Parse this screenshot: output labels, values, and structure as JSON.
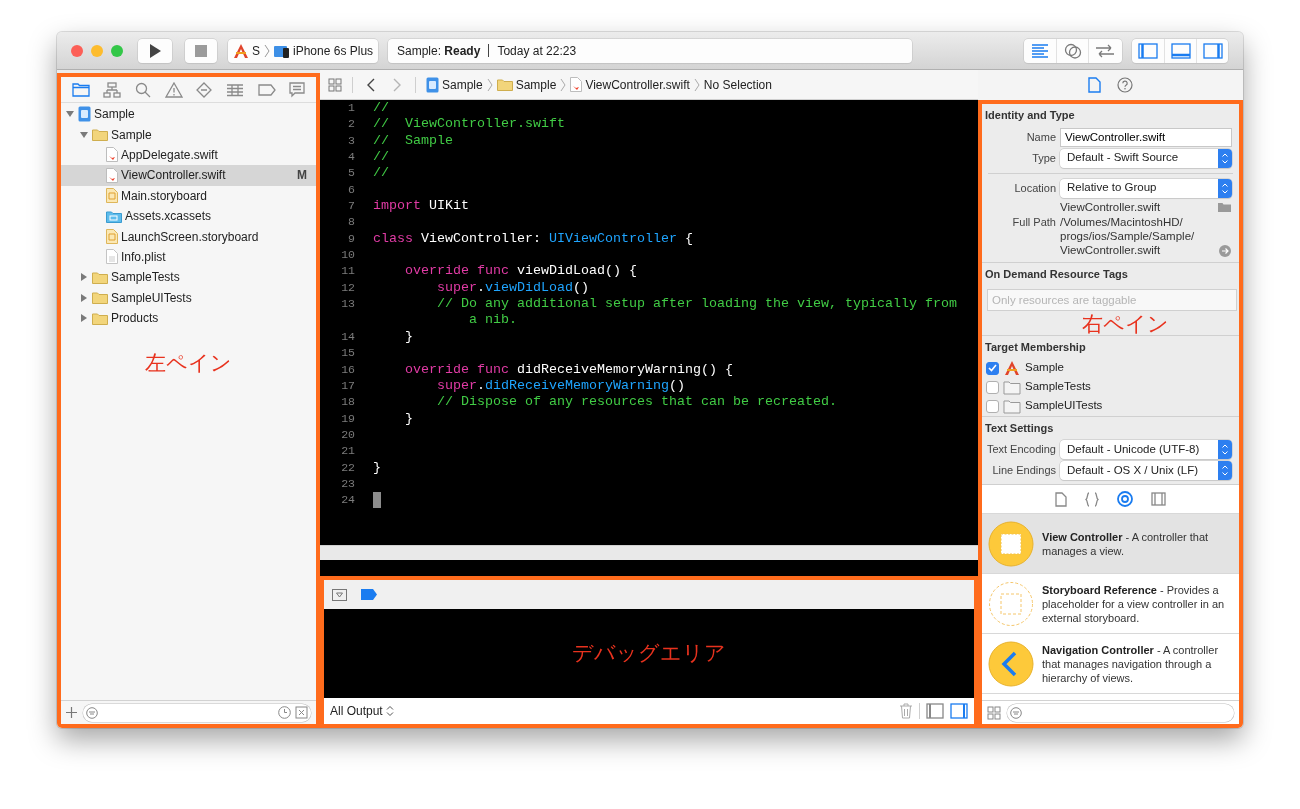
{
  "toolbar": {
    "scheme": "S",
    "destination": "iPhone 6s Plus",
    "activity": {
      "status": "Sample: **Ready**",
      "time": "Today at 22:23"
    },
    "editor_modes": [
      {
        "kind": "standard",
        "selected": true
      },
      {
        "kind": "assistant",
        "selected": false
      },
      {
        "kind": "version",
        "selected": false
      }
    ],
    "panels": [
      {
        "kind": "navigator",
        "on": true
      },
      {
        "kind": "debug",
        "on": true
      },
      {
        "kind": "utilities",
        "on": true
      }
    ]
  },
  "navigator": {
    "annotation": "左ペイン",
    "tabs": [
      {
        "kind": "project",
        "selected": true
      },
      {
        "kind": "symbol",
        "selected": false
      },
      {
        "kind": "find",
        "selected": false
      },
      {
        "kind": "issue",
        "selected": false
      },
      {
        "kind": "test",
        "selected": false
      },
      {
        "kind": "debug",
        "selected": false
      },
      {
        "kind": "breakpoint",
        "selected": false
      },
      {
        "kind": "report",
        "selected": false
      }
    ],
    "tree": [
      {
        "kind": "project",
        "name": "Sample",
        "expanded": true,
        "selected": false,
        "children": [
          {
            "kind": "folder",
            "name": "Sample",
            "expanded": true,
            "selected": false,
            "children": [
              {
                "kind": "swift",
                "name": "AppDelegate.swift",
                "selected": false
              },
              {
                "kind": "swift",
                "name": "ViewController.swift",
                "selected": true,
                "badge": "M"
              },
              {
                "kind": "storyboard",
                "name": "Main.storyboard",
                "selected": false
              },
              {
                "kind": "assets",
                "name": "Assets.xcassets",
                "selected": false
              },
              {
                "kind": "storyboard",
                "name": "LaunchScreen.storyboard",
                "selected": false
              },
              {
                "kind": "plist",
                "name": "Info.plist",
                "selected": false
              }
            ]
          },
          {
            "kind": "folder",
            "name": "SampleTests",
            "expanded": false,
            "selected": false
          },
          {
            "kind": "folder",
            "name": "SampleUITests",
            "expanded": false,
            "selected": false
          },
          {
            "kind": "folder",
            "name": "Products",
            "expanded": false,
            "selected": false
          }
        ]
      }
    ]
  },
  "editor": {
    "jump_bar": {
      "nav_buttons": [
        {
          "kind": "back",
          "disabled": false
        },
        {
          "kind": "forward",
          "disabled": true
        }
      ],
      "path": [
        {
          "kind": "project",
          "label": "Sample"
        },
        {
          "kind": "folder",
          "label": "Sample"
        },
        {
          "kind": "swift",
          "label": "ViewController.swift"
        },
        {
          "kind": "none",
          "label": "No Selection"
        }
      ]
    },
    "lines": [
      {
        "number": "1",
        "caret": false,
        "tokens": [
          {
            "kind": "comment",
            "text": "//"
          }
        ]
      },
      {
        "number": "2",
        "caret": false,
        "tokens": [
          {
            "kind": "comment",
            "text": "//  ViewController.swift"
          }
        ]
      },
      {
        "number": "3",
        "caret": false,
        "tokens": [
          {
            "kind": "comment",
            "text": "//  Sample"
          }
        ]
      },
      {
        "number": "4",
        "caret": false,
        "tokens": [
          {
            "kind": "comment",
            "text": "//"
          }
        ]
      },
      {
        "number": "5",
        "caret": false,
        "tokens": [
          {
            "kind": "comment",
            "text": "//"
          }
        ]
      },
      {
        "number": "6",
        "caret": false
      },
      {
        "number": "7",
        "caret": false,
        "tokens": [
          {
            "kind": "keyword",
            "text": "import"
          },
          {
            "kind": "plain",
            "text": " UIKit"
          }
        ]
      },
      {
        "number": "8",
        "caret": false
      },
      {
        "number": "9",
        "caret": false,
        "tokens": [
          {
            "kind": "keyword",
            "text": "class"
          },
          {
            "kind": "plain",
            "text": " ViewController: "
          },
          {
            "kind": "type",
            "text": "UIViewController"
          },
          {
            "kind": "plain",
            "text": " {"
          }
        ]
      },
      {
        "number": "10",
        "caret": false
      },
      {
        "number": "11",
        "caret": false,
        "tokens": [
          {
            "kind": "keyword",
            "text": "    override"
          },
          {
            "kind": "keyword",
            "text": " func"
          },
          {
            "kind": "plain",
            "text": " viewDidLoad() {"
          }
        ]
      },
      {
        "number": "12",
        "caret": false,
        "tokens": [
          {
            "kind": "keyword",
            "text": "        super"
          },
          {
            "kind": "plain",
            "text": "."
          },
          {
            "kind": "call",
            "text": "viewDidLoad"
          },
          {
            "kind": "plain",
            "text": "()"
          }
        ]
      },
      {
        "number": "13",
        "caret": false,
        "tokens": [
          {
            "kind": "comment",
            "text": "        // Do any additional setup after loading the view, typically from a nib."
          }
        ]
      },
      {
        "number": "14",
        "caret": false,
        "tokens": [
          {
            "kind": "plain",
            "text": "    }"
          }
        ]
      },
      {
        "number": "15",
        "caret": false
      },
      {
        "number": "16",
        "caret": false,
        "tokens": [
          {
            "kind": "keyword",
            "text": "    override"
          },
          {
            "kind": "keyword",
            "text": " func"
          },
          {
            "kind": "plain",
            "text": " didReceiveMemoryWarning() {"
          }
        ]
      },
      {
        "number": "17",
        "caret": false,
        "tokens": [
          {
            "kind": "keyword",
            "text": "        super"
          },
          {
            "kind": "plain",
            "text": "."
          },
          {
            "kind": "call",
            "text": "didReceiveMemoryWarning"
          },
          {
            "kind": "plain",
            "text": "()"
          }
        ]
      },
      {
        "number": "18",
        "caret": false,
        "tokens": [
          {
            "kind": "comment",
            "text": "        // Dispose of any resources that can be recreated."
          }
        ]
      },
      {
        "number": "19",
        "caret": false,
        "tokens": [
          {
            "kind": "plain",
            "text": "    }"
          }
        ]
      },
      {
        "number": "20",
        "caret": false
      },
      {
        "number": "21",
        "caret": false
      },
      {
        "number": "22",
        "caret": false,
        "tokens": [
          {
            "kind": "plain",
            "text": "}"
          }
        ]
      },
      {
        "number": "23",
        "caret": false
      },
      {
        "number": "24",
        "caret": true
      }
    ]
  },
  "debug_area": {
    "annotation": "デバッグエリア",
    "breakpoints_active": true,
    "output_filter": "All Output",
    "views": [
      {
        "kind": "variables",
        "on": false
      },
      {
        "kind": "console",
        "on": true
      }
    ]
  },
  "inspector": {
    "annotation": "右ペイン",
    "tabs": [
      {
        "kind": "file",
        "selected": true
      },
      {
        "kind": "help",
        "selected": false
      }
    ],
    "sections": [
      {
        "title": "Identity and Type",
        "rows": [
          {
            "kind": "field",
            "label": "Name",
            "value": "ViewController.swift"
          },
          {
            "kind": "popup",
            "label": "Type",
            "value": "Default - Swift Source"
          },
          {
            "kind": "divider"
          },
          {
            "kind": "popup",
            "label": "Location",
            "value": "Relative to Group"
          },
          {
            "kind": "file",
            "value": "ViewController.swift"
          },
          {
            "kind": "path",
            "label": "Full Path",
            "lines": [
              "/Volumes/MacintoshHD/",
              "progs/ios/Sample/Sample/",
              "ViewController.swift"
            ]
          }
        ]
      },
      {
        "title": "On Demand Resource Tags",
        "rows": [
          {
            "kind": "tags",
            "placeholder": "Only resources are taggable"
          },
          {
            "kind": "annotation"
          }
        ]
      },
      {
        "title": "Target Membership",
        "targets": [
          {
            "kind": "app",
            "label": "Sample",
            "checked": true
          },
          {
            "kind": "bundle",
            "label": "SampleTests",
            "checked": false
          },
          {
            "kind": "bundle",
            "label": "SampleUITests",
            "checked": false
          }
        ]
      },
      {
        "title": "Text Settings",
        "rows": [
          {
            "kind": "popup",
            "label": "Text Encoding",
            "value": "Default - Unicode (UTF-8)"
          },
          {
            "kind": "popup",
            "label": "Line Endings",
            "value": "Default - OS X / Unix (LF)"
          }
        ]
      }
    ]
  },
  "library": {
    "tabs": [
      {
        "kind": "file",
        "selected": false
      },
      {
        "kind": "code",
        "selected": false
      },
      {
        "kind": "object",
        "selected": true
      },
      {
        "kind": "media",
        "selected": false
      }
    ],
    "items": [
      {
        "kind": "view-controller",
        "text": "**View Controller** - A controller that manages a view.",
        "selected": true
      },
      {
        "kind": "storyboard-reference",
        "text": "**Storyboard Reference** - Provides a placeholder for a view controller in an external storyboard.",
        "selected": false
      },
      {
        "kind": "navigation-controller",
        "text": "**Navigation Controller** - A controller that manages navigation through a hierarchy of views.",
        "selected": false
      }
    ]
  }
}
